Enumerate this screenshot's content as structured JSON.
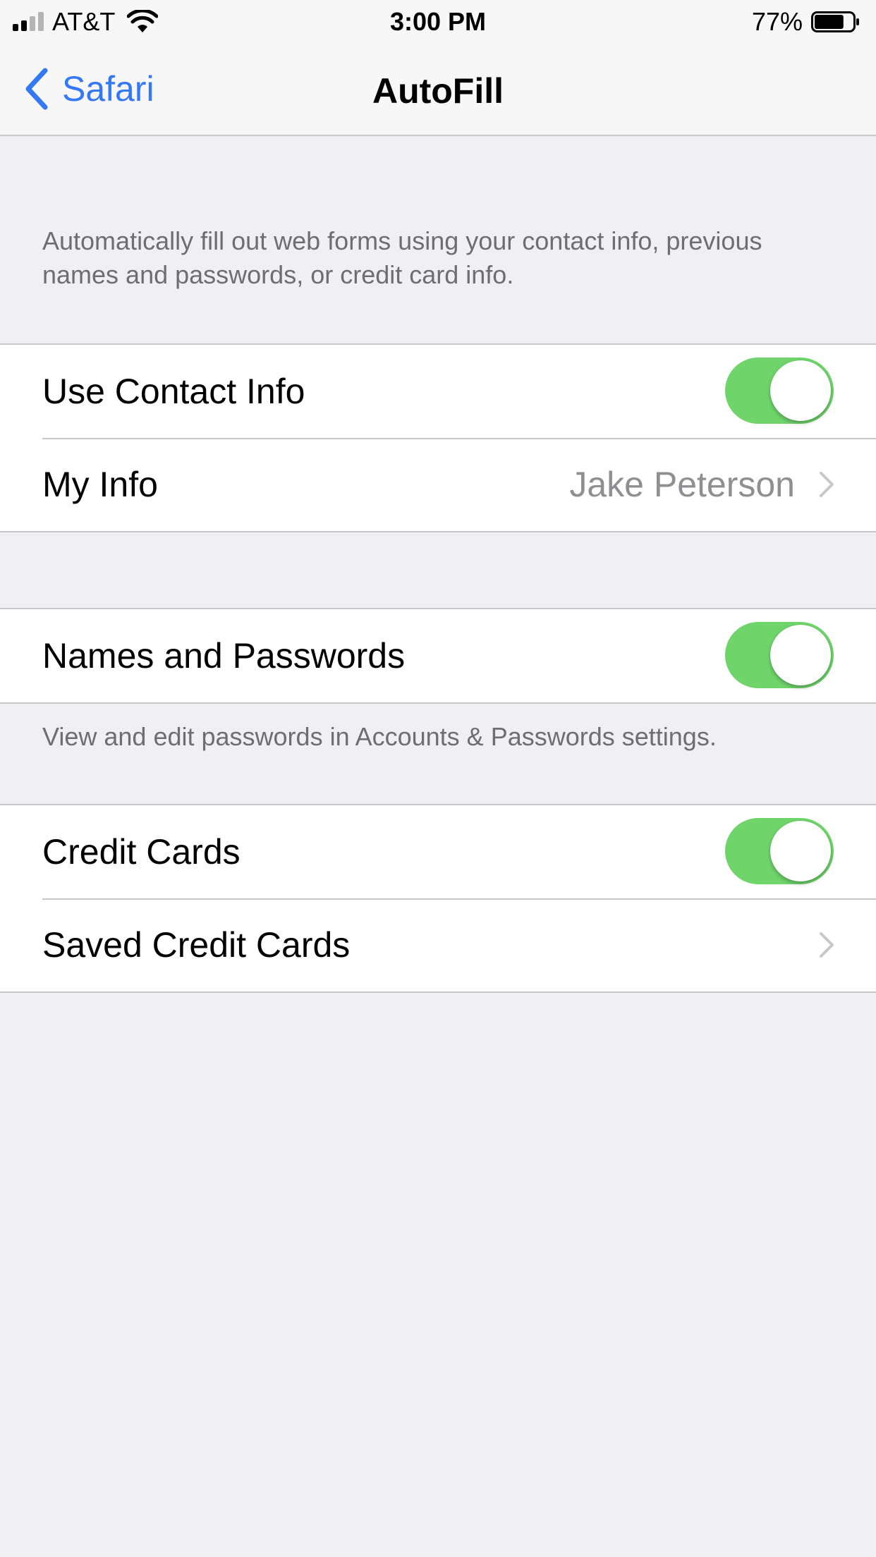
{
  "status_bar": {
    "carrier": "AT&T",
    "time": "3:00 PM",
    "battery_percent": "77%",
    "battery_level": 0.77,
    "signal_bars": 2,
    "signal_icon": "signal-bars-icon",
    "wifi_icon": "wifi-icon",
    "battery_icon": "battery-icon"
  },
  "nav": {
    "back_label": "Safari",
    "back_icon": "chevron-left-icon",
    "title": "AutoFill"
  },
  "intro_description": "Automatically fill out web forms using your contact info, previous names and passwords, or credit card info.",
  "contact_group": {
    "use_contact_info": {
      "label": "Use Contact Info",
      "on": true
    },
    "my_info": {
      "label": "My Info",
      "value": "Jake Peterson",
      "icon": "chevron-right-icon"
    }
  },
  "passwords_group": {
    "names_and_passwords": {
      "label": "Names and Passwords",
      "on": true
    },
    "footer": "View and edit passwords in Accounts & Passwords settings."
  },
  "cards_group": {
    "credit_cards": {
      "label": "Credit Cards",
      "on": true
    },
    "saved_credit_cards": {
      "label": "Saved Credit Cards",
      "icon": "chevron-right-icon"
    }
  },
  "colors": {
    "accent": "#3478f6",
    "toggle_on": "#6fd56b",
    "background": "#efeff4",
    "secondary_text": "#6d6d72"
  }
}
